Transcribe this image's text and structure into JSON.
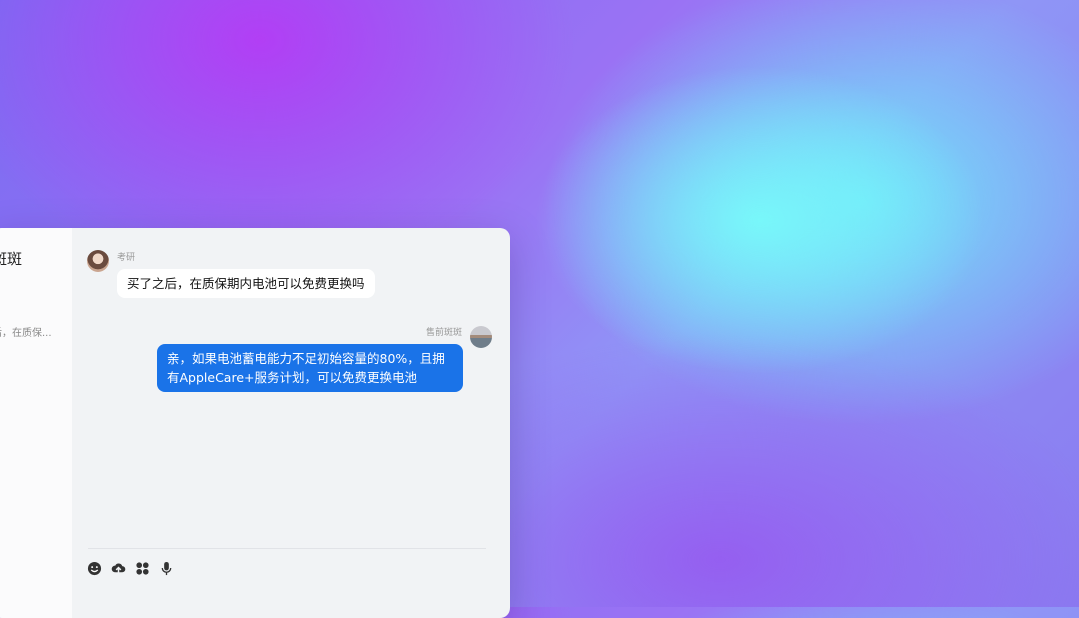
{
  "sidebar": {
    "contact_name_partial": "斑斑",
    "last_message_preview": "后，在质保..."
  },
  "chat": {
    "messages": [
      {
        "sender": "考研",
        "side": "left",
        "text": "买了之后，在质保期内电池可以免费更换吗"
      },
      {
        "sender": "售前斑斑",
        "side": "right",
        "text": "亲，如果电池蓄电能力不足初始容量的80%，且拥有AppleCare+服务计划，可以免费更换电池"
      }
    ]
  },
  "toolbar": {
    "icons": [
      "emoji-icon",
      "upload-icon",
      "apps-icon",
      "microphone-icon"
    ]
  },
  "colors": {
    "agent_bubble": "#1a73e8",
    "customer_bubble": "#ffffff",
    "chat_background": "#f1f3f5"
  }
}
